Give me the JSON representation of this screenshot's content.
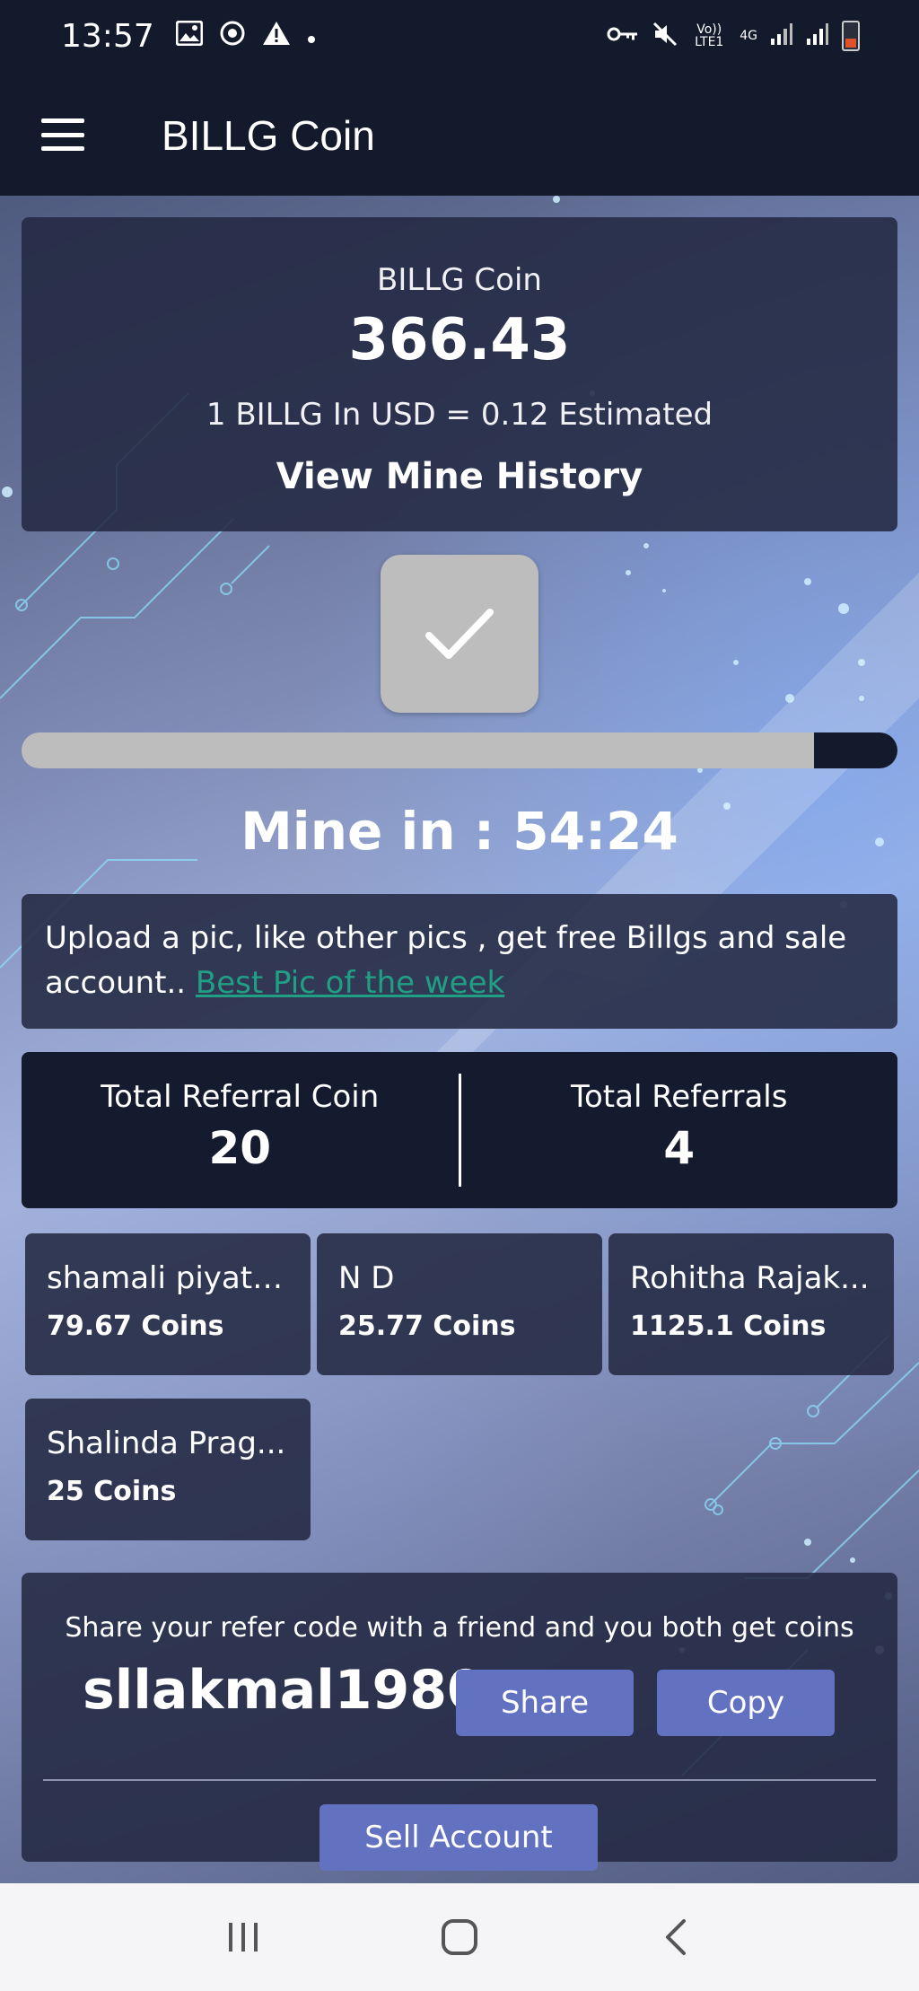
{
  "status_bar": {
    "time": "13:57",
    "volte_label": "Vo)) LTE1",
    "network_label": "4G"
  },
  "app_bar": {
    "title": "BILLG Coin"
  },
  "balance": {
    "label": "BILLG Coin",
    "value": "366.43",
    "rate": "1 BILLG In USD = 0.12 Estimated",
    "history_link": "View Mine History"
  },
  "mining": {
    "progress_remaining_fraction": 0.095,
    "timer_text": "Mine in : 54:24"
  },
  "upload": {
    "text": "Upload a pic, like other pics , get free Billgs and sale account.. ",
    "link_text": "Best Pic of the week "
  },
  "referral_stats": {
    "coin_label": "Total Referral Coin",
    "coin_value": "20",
    "count_label": "Total Referrals",
    "count_value": "4"
  },
  "referrals": [
    {
      "name": "shamali piyath...",
      "coins": "79.67 Coins"
    },
    {
      "name": "N D",
      "coins": "25.77 Coins"
    },
    {
      "name": "Rohitha Rajak...",
      "coins": "1125.1 Coins"
    },
    {
      "name": "Shalinda Prag...",
      "coins": "25 Coins"
    }
  ],
  "share": {
    "text": "Share your refer code with a friend and you both get coins",
    "code": "sllakmal1980",
    "share_label": "Share",
    "copy_label": "Copy",
    "sell_label": "Sell Account"
  },
  "colors": {
    "header_bg": "#131a2c",
    "card_bg": "#232942",
    "button": "#6271c0",
    "link": "#1fa085",
    "check_btn": "#bdbdbd"
  }
}
